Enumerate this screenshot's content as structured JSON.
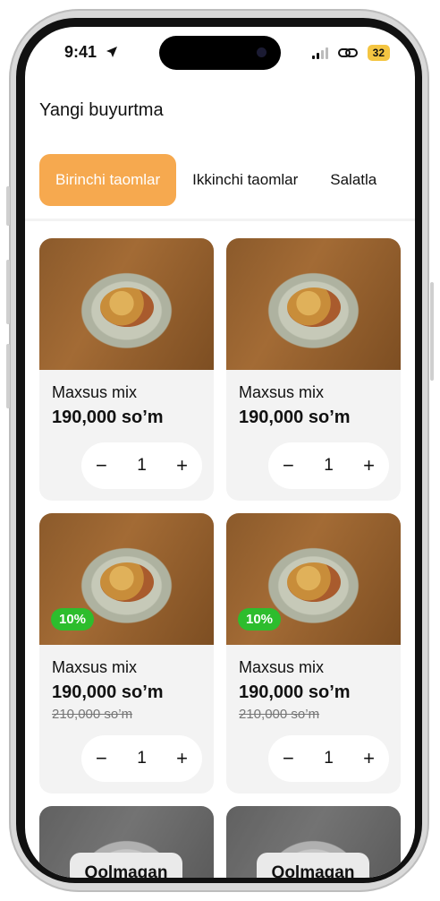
{
  "status": {
    "time": "9:41",
    "battery": "32"
  },
  "header": {
    "title": "Yangi buyurtma"
  },
  "tabs": [
    {
      "label": "Birinchi taomlar",
      "active": true
    },
    {
      "label": "Ikkinchi taomlar",
      "active": false
    },
    {
      "label": "Salatla",
      "active": false
    }
  ],
  "products": [
    {
      "name": "Maxsus mix",
      "price": "190,000 so’m",
      "quantity": "1",
      "minus": "−",
      "plus": "+"
    },
    {
      "name": "Maxsus mix",
      "price": "190,000 so’m",
      "quantity": "1",
      "minus": "−",
      "plus": "+"
    },
    {
      "name": "Maxsus mix",
      "price": "190,000 so’m",
      "old_price": "210,000 so’m",
      "discount": "10%",
      "quantity": "1",
      "minus": "−",
      "plus": "+"
    },
    {
      "name": "Maxsus mix",
      "price": "190,000 so’m",
      "old_price": "210,000 so’m",
      "discount": "10%",
      "quantity": "1",
      "minus": "−",
      "plus": "+"
    },
    {
      "soldout": "Qolmagan"
    },
    {
      "soldout": "Qolmagan"
    }
  ],
  "colors": {
    "accent": "#f6a94f",
    "discount": "#2dbd2d",
    "card": "#f3f3f3"
  }
}
